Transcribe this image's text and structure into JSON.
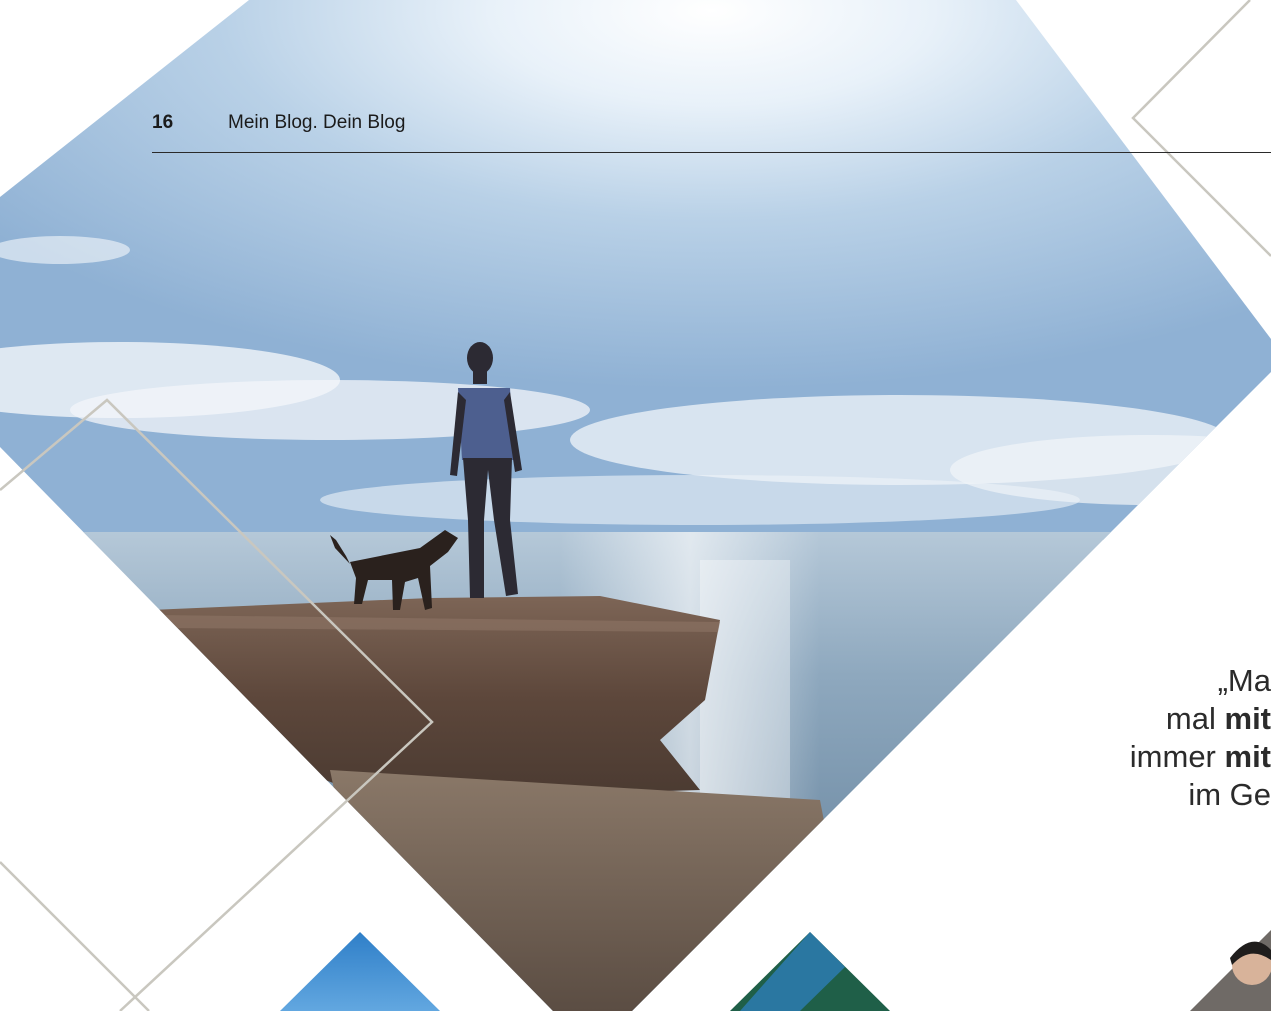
{
  "header": {
    "page_number": "16",
    "section_title": "Mein Blog. Dein Blog"
  },
  "quote": {
    "line1": "„Ma",
    "line2_normal": "mal ",
    "line2_bold": "mit",
    "line3_normal": "immer ",
    "line3_bold": "mit",
    "line4": "im Ge"
  },
  "colors": {
    "outline": "#c9c7bf",
    "rule": "#2a2a2a",
    "text": "#1b1b1b",
    "sky_top": "#9fbfdd",
    "sea": "#6f8fa8",
    "rock": "#6b5346"
  },
  "images": {
    "main_photo": "woman-and-dog-on-cliff-by-sea",
    "thumb_left": "blue-sky-thumbnail",
    "thumb_middle": "tree-sky-thumbnail",
    "thumb_right": "portrait-thumbnail"
  }
}
